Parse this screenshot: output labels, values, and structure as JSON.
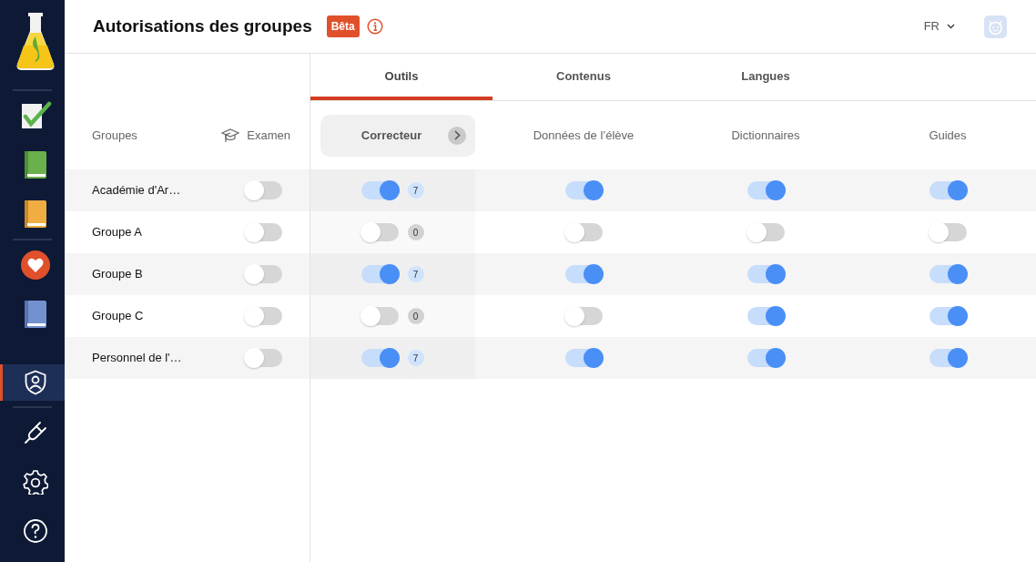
{
  "sidebar": {
    "sections": [
      {
        "items": [
          {
            "selected": false
          }
        ]
      },
      {
        "items": [
          {
            "selected": false
          },
          {
            "selected": false
          },
          {
            "selected": false
          }
        ]
      },
      {
        "items": [
          {
            "selected": false
          },
          {
            "selected": false
          }
        ]
      },
      {
        "items": [
          {
            "selected": true
          }
        ]
      },
      {
        "items": [
          {
            "selected": false
          },
          {
            "selected": false
          },
          {
            "selected": false
          }
        ]
      }
    ]
  },
  "header": {
    "title": "Autorisations des groupes",
    "badge": "Bêta",
    "language": "FR"
  },
  "tabs": [
    {
      "label": "Outils",
      "selected": true
    },
    {
      "label": "Contenus",
      "selected": false
    },
    {
      "label": "Langues",
      "selected": false
    }
  ],
  "group_columns": [
    "Groupes",
    "Examen"
  ],
  "columns": [
    {
      "label": "Correcteur",
      "selected": true
    },
    {
      "label": "Données de l’élève",
      "selected": false
    },
    {
      "label": "Dictionnaires",
      "selected": false
    },
    {
      "label": "Guides",
      "selected": false
    }
  ],
  "groups": [
    {
      "name": "Académie d'Ar…",
      "exam": false,
      "cells": [
        {
          "on": true,
          "count": "7"
        },
        {
          "on": true
        },
        {
          "on": true
        },
        {
          "on": true
        }
      ]
    },
    {
      "name": "Groupe A",
      "exam": false,
      "cells": [
        {
          "on": false,
          "count": "0"
        },
        {
          "on": false
        },
        {
          "on": false
        },
        {
          "on": false
        }
      ]
    },
    {
      "name": "Groupe B",
      "exam": false,
      "cells": [
        {
          "on": true,
          "count": "7"
        },
        {
          "on": true
        },
        {
          "on": true
        },
        {
          "on": true
        }
      ]
    },
    {
      "name": "Groupe C",
      "exam": false,
      "cells": [
        {
          "on": false,
          "count": "0"
        },
        {
          "on": false
        },
        {
          "on": true
        },
        {
          "on": true
        }
      ]
    },
    {
      "name": "Personnel de l'…",
      "exam": false,
      "cells": [
        {
          "on": true,
          "count": "7"
        },
        {
          "on": true
        },
        {
          "on": true
        },
        {
          "on": true
        }
      ]
    }
  ]
}
